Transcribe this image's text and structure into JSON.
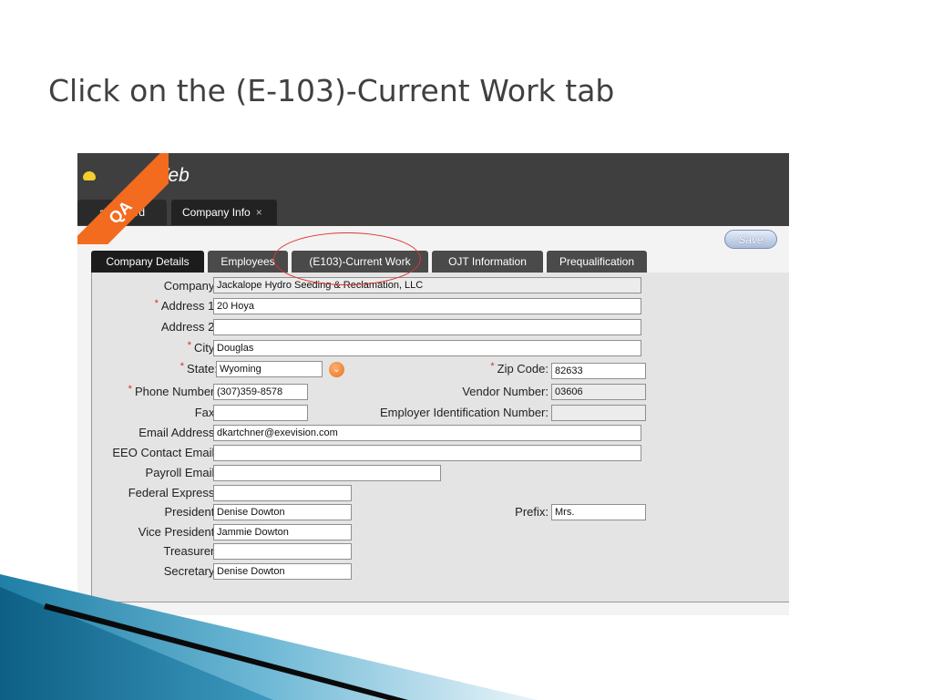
{
  "slide": {
    "title": "Click on the (E-103)-Current Work tab"
  },
  "app": {
    "name": "Web",
    "badge": "QA",
    "main_tabs": [
      {
        "label": "ashboard"
      },
      {
        "label": "Company Info",
        "close": "×"
      }
    ],
    "save_label": "Save",
    "sub_tabs": [
      {
        "label": "Company Details",
        "active": true
      },
      {
        "label": "Employees"
      },
      {
        "label": "(E103)-Current Work",
        "highlighted": true
      },
      {
        "label": "OJT Information"
      },
      {
        "label": "Prequalification"
      }
    ],
    "required_marker": "*"
  },
  "form": {
    "company": {
      "label": "Company:",
      "value": "Jackalope Hydro Seeding & Reclamation, LLC"
    },
    "address1": {
      "label": "Address 1:",
      "value": "20 Hoya"
    },
    "address2": {
      "label": "Address 2:",
      "value": ""
    },
    "city": {
      "label": "City:",
      "value": "Douglas"
    },
    "state": {
      "label": "State:",
      "value": "Wyoming"
    },
    "zip": {
      "label": "Zip Code:",
      "value": "82633"
    },
    "phone": {
      "label": "Phone Number:",
      "value": "(307)359-8578"
    },
    "vendor": {
      "label": "Vendor Number:",
      "value": "03606"
    },
    "fax": {
      "label": "Fax:",
      "value": ""
    },
    "ein": {
      "label": "Employer Identification Number:",
      "value": ""
    },
    "email": {
      "label": "Email Address:",
      "value": "dkartchner@exevision.com"
    },
    "eeo_email": {
      "label": "EEO Contact Email:",
      "value": ""
    },
    "payroll_email": {
      "label": "Payroll Email:",
      "value": ""
    },
    "fedex": {
      "label": "Federal Express:",
      "value": ""
    },
    "president": {
      "label": "President:",
      "value": "Denise Dowton"
    },
    "prefix": {
      "label": "Prefix:",
      "value": "Mrs."
    },
    "vice_president": {
      "label": "Vice President:",
      "value": "Jammie Dowton"
    },
    "treasurer": {
      "label": "Treasurer:",
      "value": ""
    },
    "secretary": {
      "label": "Secretary:",
      "value": "Denise Dowton"
    }
  },
  "colors": {
    "accent": "#f26b1f",
    "highlight": "#e03535",
    "dark_bar": "#3f3f3f"
  }
}
